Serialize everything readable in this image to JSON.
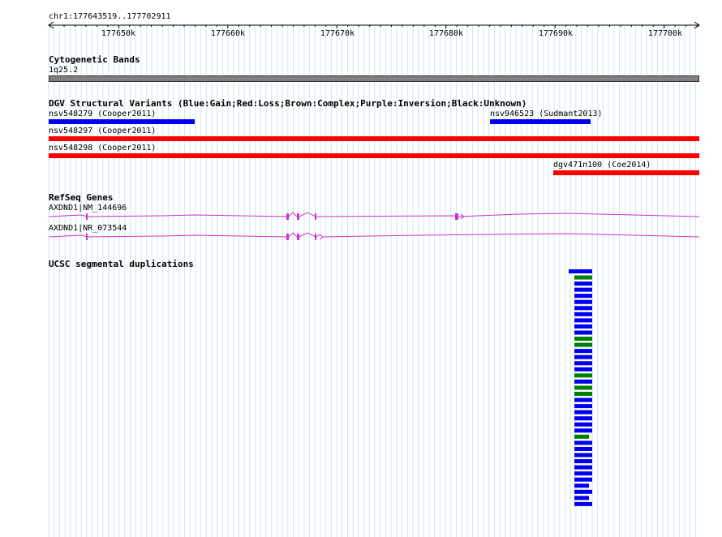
{
  "browser": {
    "position": "chr1:177643519..177702911",
    "ruler_ticks": [
      "177650k",
      "177660k",
      "177670k",
      "177680k",
      "177690k",
      "177700k"
    ]
  },
  "tracks": {
    "cytoband": {
      "title": "Cytogenetic Bands",
      "band_label": "1q25.2",
      "band_color": "#808080"
    },
    "dgv": {
      "title": "DGV Structural Variants (Blue:Gain;Red:Loss;Brown:Complex;Purple:Inversion;Black:Unknown)",
      "features": [
        {
          "label": "nsv548279 (Cooper2011)",
          "type": "gain",
          "color": "#0000ee"
        },
        {
          "label": "nsv946523 (Sudmant2013)",
          "type": "gain",
          "color": "#0000ee"
        },
        {
          "label": "nsv548297 (Cooper2011)",
          "type": "loss",
          "color": "#ff0000"
        },
        {
          "label": "nsv548298 (Cooper2011)",
          "type": "loss",
          "color": "#ff0000"
        },
        {
          "label": "dgv471n100 (Coe2014)",
          "type": "loss",
          "color": "#ff0000"
        }
      ]
    },
    "refseq": {
      "title": "RefSeq Genes",
      "color": "#cc33cc",
      "transcripts": [
        {
          "label": "AXDND1|NM_144696"
        },
        {
          "label": "AXDND1|NR_073544"
        }
      ]
    },
    "segdups": {
      "title": "UCSC segmental duplications",
      "colors": {
        "blue": "#0000ee",
        "green": "#008000"
      },
      "features": [
        "blue",
        "green",
        "blue",
        "blue",
        "blue",
        "blue",
        "blue",
        "blue",
        "blue",
        "blue",
        "blue",
        "green",
        "green",
        "blue",
        "blue",
        "blue",
        "blue",
        "green",
        "blue",
        "green",
        "green",
        "blue",
        "blue",
        "blue",
        "blue",
        "blue",
        "blue",
        "green",
        "blue",
        "blue",
        "blue",
        "blue",
        "blue",
        "blue",
        "blue",
        "blue",
        "blue",
        "blue",
        "blue"
      ]
    }
  }
}
